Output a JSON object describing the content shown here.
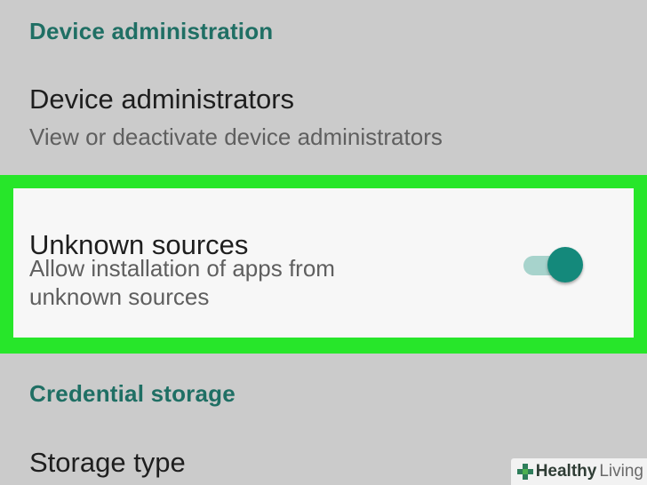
{
  "sections": {
    "device_administration": {
      "header": "Device administration",
      "device_administrators": {
        "title": "Device administrators",
        "summary": "View or deactivate device administrators"
      },
      "unknown_sources": {
        "title": "Unknown sources",
        "summary_line1": "Allow installation of apps from",
        "summary_line2": "unknown sources",
        "enabled": true
      }
    },
    "credential_storage": {
      "header": "Credential storage",
      "storage_type": {
        "title": "Storage type"
      }
    }
  },
  "watermark": {
    "brand_bold": "Healthy",
    "brand_light": "Living"
  },
  "colors": {
    "accent": "#1f6f64",
    "highlight": "#27e62a",
    "switch_thumb": "#14897b",
    "switch_track": "#a7d3cc",
    "background": "#cbcbcb"
  }
}
